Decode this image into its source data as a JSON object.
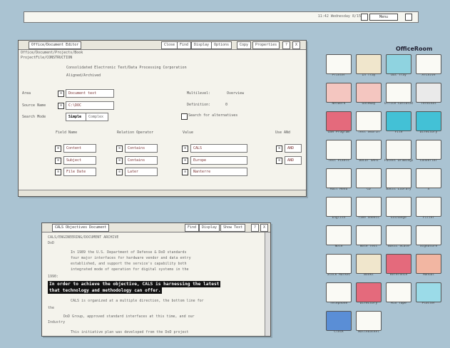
{
  "topbar": {
    "title": "11:42 Wednesday 8/15",
    "selector": "Menu"
  },
  "window1": {
    "title": "Office/Document Editor",
    "commands": [
      "Close",
      "Find",
      "Display",
      "Options",
      "Copy",
      "Properties",
      "?",
      "X"
    ],
    "breadcrumb": "Office/Document/Projects/Book",
    "breadcrumb2": "ProjectFile/CONSTRUCTION",
    "heading": "Consolidated Electronic Text/Data Processing Corporation",
    "subheading": "Aligned/Archived",
    "form": {
      "area_label": "Area",
      "area_value": "Document text",
      "source_label": "Source Name",
      "source_value": "C:\\DOC",
      "search_label": "Search Mode",
      "search_simple": "Simple",
      "search_complex": "Complex",
      "multilevel_label": "Multilevel:",
      "multilevel_value": "Overview",
      "definition_label": "Definition:",
      "definition_value": "0",
      "checkbox_label": "Search for alternatives"
    },
    "columns": {
      "field": "Field Name",
      "relation": "Relation Operator",
      "value": "Value",
      "use": "Use ANd"
    },
    "rows": [
      {
        "field": "Content",
        "relation": "Contains",
        "value": "CALS",
        "use": "AND"
      },
      {
        "field": "Subject",
        "relation": "Contains",
        "value": "Europe",
        "use": "AND"
      },
      {
        "field": "File Date",
        "relation": "Later",
        "value": "Nanterre",
        "use": ""
      }
    ]
  },
  "window2": {
    "title": "CALS Objectives Document",
    "commands": [
      "Find",
      "Display",
      "Show Text",
      "?",
      "X"
    ],
    "lines": [
      "CALS/ENGINEERING/DOCUMENT ARCHIVE",
      "DoD",
      "In 1989 the U.S. Department of Defense & DoD standards",
      "four major interfaces for hardware vendor and data entry",
      "established, and support the service's capability both",
      "integrated mode of operation for digital systems in the"
    ],
    "marker": "1990:",
    "highlight1": "In order to achieve the objective, CALS is harnessing the latest",
    "highlight2": "that technology and methodology can offer.",
    "after": [
      "CALS is organized at a multiple direction, the bottom line for",
      "the",
      "DoD Group, approved standard interfaces at this time, and our",
      "Industry"
    ],
    "bottom": "This initiative plan was developed from the DoD project"
  },
  "officeroom": {
    "title": "OfficeRoom",
    "icons": [
      {
        "name": "printer-icon",
        "label": "Printer"
      },
      {
        "name": "in-tray-icon",
        "label": "In Tray"
      },
      {
        "name": "out-tray-icon",
        "label": "Out Tray"
      },
      {
        "name": "archive-icon",
        "label": "Archive"
      },
      {
        "name": "globe-icon",
        "label": "Network"
      },
      {
        "name": "globe-icon-2",
        "label": "Gateway"
      },
      {
        "name": "calculator-icon",
        "label": "Office Calculator"
      },
      {
        "name": "terminal-icon",
        "label": "Terminal"
      },
      {
        "name": "dsr-program-icon",
        "label": "DSR Program"
      },
      {
        "name": "text-search-icon",
        "label": "Text Search"
      },
      {
        "name": "folder-teal-icon",
        "label": "File"
      },
      {
        "name": "folder-teal-icon-2",
        "label": "Directory"
      },
      {
        "name": "text-to-pixels-icon",
        "label": "Text Pixels"
      },
      {
        "name": "docusafe-icon",
        "label": "DOCUT SAFE"
      },
      {
        "name": "patent-drawings-icon",
        "label": "Patent Drawings"
      },
      {
        "name": "converter-icon",
        "label": "Converter"
      },
      {
        "name": "mail-icon",
        "label": "Mail Menu"
      },
      {
        "name": "clipboard-icon",
        "label": "CD"
      },
      {
        "name": "basic-library-icon",
        "label": "Basic Library"
      },
      {
        "name": "x-windows-icon",
        "label": "X"
      },
      {
        "name": "english-icon",
        "label": "English"
      },
      {
        "name": "time-sheets-icon",
        "label": "Time Sheets"
      },
      {
        "name": "exchange-icon",
        "label": "Exchange"
      },
      {
        "name": "filter-icon",
        "label": "Filter"
      },
      {
        "name": "note-icon",
        "label": "Note"
      },
      {
        "name": "note-test-icon",
        "label": "Note Test"
      },
      {
        "name": "basic-scale-icon",
        "label": "Basic Scale"
      },
      {
        "name": "signature-icon",
        "label": "Signature"
      },
      {
        "name": "stock-icon",
        "label": "Stock Market"
      },
      {
        "name": "books-icon",
        "label": "Books"
      },
      {
        "name": "red-book-icon",
        "label": "Reference"
      },
      {
        "name": "orange-book-icon",
        "label": "Manual"
      },
      {
        "name": "phone-icon",
        "label": "Telephone"
      },
      {
        "name": "directory-icon",
        "label": "Directory"
      },
      {
        "name": "mix-tape-icon",
        "label": "Mix Tape"
      },
      {
        "name": "plotter-icon",
        "label": "Plotter"
      },
      {
        "name": "clock-icon",
        "label": "Clock"
      },
      {
        "name": "wastebasket-icon",
        "label": "Wastebasket"
      }
    ]
  }
}
